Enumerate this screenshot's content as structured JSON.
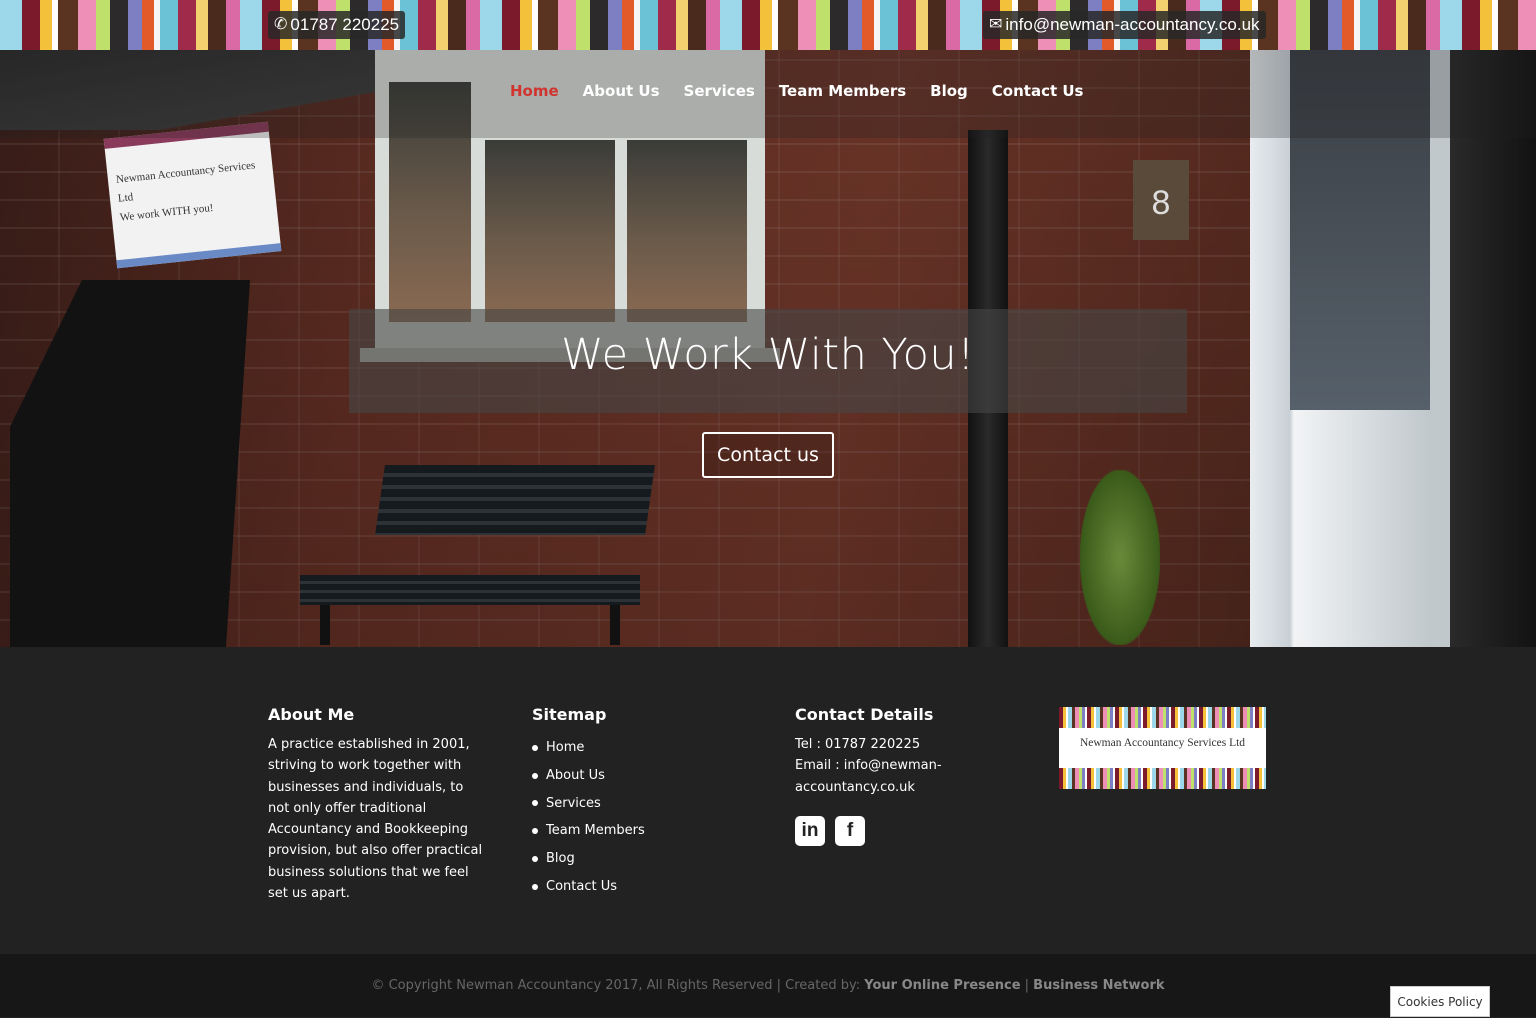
{
  "topbar": {
    "phone": "01787 220225",
    "email": "info@newman-accountancy.co.uk"
  },
  "nav": {
    "items": [
      {
        "label": "Home",
        "active": true
      },
      {
        "label": "About Us"
      },
      {
        "label": "Services"
      },
      {
        "label": "Team Members"
      },
      {
        "label": "Blog"
      },
      {
        "label": "Contact Us"
      }
    ]
  },
  "hero": {
    "title": "We Work With You!",
    "cta": "Contact us",
    "sign_line1": "Newman Accountancy Services Ltd",
    "sign_line2": "We work WITH you!",
    "unit_number": "8"
  },
  "footer": {
    "about": {
      "heading": "About Me",
      "text": "A practice established in 2001, striving to work together with businesses and individuals, to not only offer traditional Accountancy and Bookkeeping provision, but also offer practical business solutions that we feel set us apart."
    },
    "sitemap": {
      "heading": "Sitemap",
      "items": [
        "Home",
        "About Us",
        "Services",
        "Team Members",
        "Blog",
        "Contact Us"
      ]
    },
    "contact": {
      "heading": "Contact Details",
      "tel": "Tel : 01787 220225",
      "email": "Email : info@newman-accountancy.co.uk",
      "linkedin": "in",
      "facebook": "f"
    },
    "logo_name": "Newman Accountancy Services Ltd"
  },
  "bottom": {
    "copyright_prefix": "© Copyright Newman Accountancy 2017, All Rights Reserved | Created by: ",
    "link1": "Your Online Presence",
    "sep": " | ",
    "link2": "Business Network",
    "cookies": "Cookies Policy"
  },
  "colors": {
    "nav_active": "#d1332f",
    "footer_bg": "#222222"
  }
}
